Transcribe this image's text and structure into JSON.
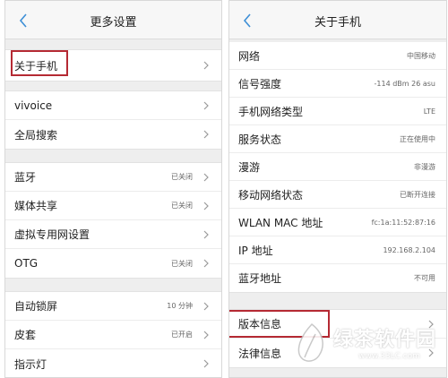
{
  "left": {
    "title": "更多设置",
    "groups": [
      [
        {
          "label": "关于手机",
          "value": ""
        }
      ],
      [
        {
          "label": "vivoice",
          "value": ""
        },
        {
          "label": "全局搜索",
          "value": ""
        }
      ],
      [
        {
          "label": "蓝牙",
          "value": "已关闭"
        },
        {
          "label": "媒体共享",
          "value": "已关闭"
        },
        {
          "label": "虚拟专用网设置",
          "value": ""
        },
        {
          "label": "OTG",
          "value": "已关闭"
        }
      ],
      [
        {
          "label": "自动锁屏",
          "value": "10 分钟"
        },
        {
          "label": "皮套",
          "value": "已开启"
        },
        {
          "label": "指示灯",
          "value": ""
        }
      ]
    ]
  },
  "right": {
    "title": "关于手机",
    "groups": [
      [
        {
          "label": "网络",
          "value": "中国移动"
        },
        {
          "label": "信号强度",
          "value": "-114 dBm  26 asu"
        },
        {
          "label": "手机网络类型",
          "value": "LTE"
        },
        {
          "label": "服务状态",
          "value": "正在使用中"
        },
        {
          "label": "漫游",
          "value": "非漫游"
        },
        {
          "label": "移动网络状态",
          "value": "已断开连接"
        },
        {
          "label": "WLAN MAC 地址",
          "value": "fc:1a:11:52:87:16"
        },
        {
          "label": "IP 地址",
          "value": "192.168.2.104"
        },
        {
          "label": "蓝牙地址",
          "value": "不可用"
        }
      ],
      [
        {
          "label": "版本信息",
          "value": ""
        },
        {
          "label": "法律信息",
          "value": ""
        }
      ]
    ]
  },
  "watermark": {
    "text": "绿茶软件园",
    "url": "www.33LC.com"
  },
  "colors": {
    "highlight": "#b52a33",
    "accent": "#3d8fd6"
  }
}
